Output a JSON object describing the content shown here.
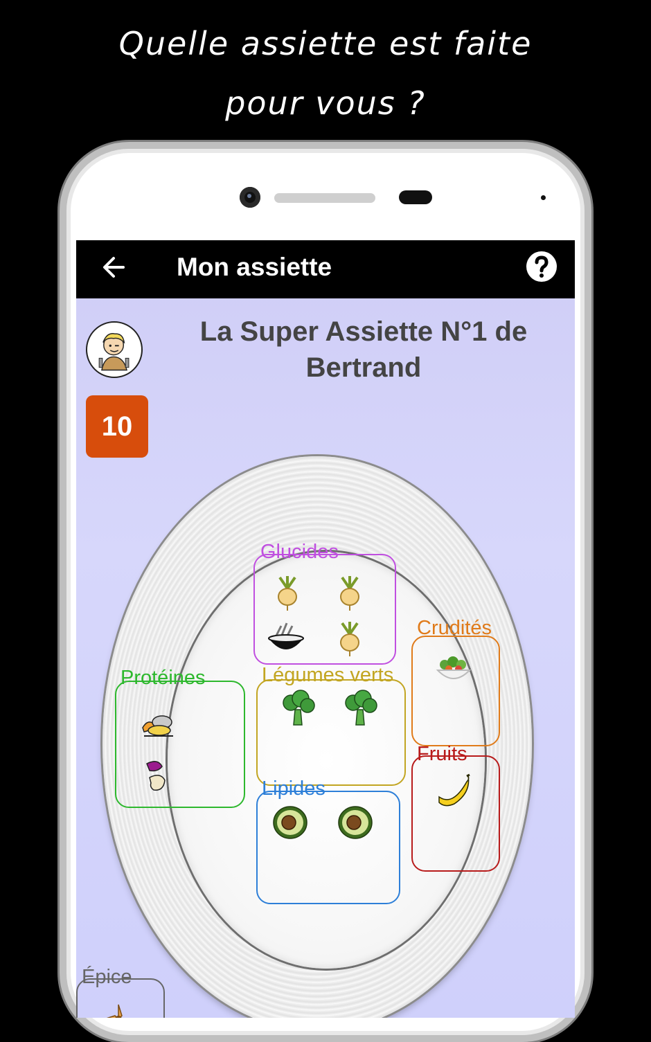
{
  "promo": {
    "line1": "Quelle assiette est faite",
    "line2": "pour vous ?"
  },
  "appbar": {
    "title": "Mon assiette",
    "back_icon": "arrow-left-icon",
    "help_icon": "help-circle-icon"
  },
  "header": {
    "title": "La Super Assiette N°1 de Bertrand",
    "score": "10"
  },
  "zones": {
    "glucides": {
      "label": "Glucides",
      "color": "#c04fe0"
    },
    "cruditees": {
      "label": "Crudités",
      "color": "#e07b1a"
    },
    "proteines": {
      "label": "Protéines",
      "color": "#2db82d"
    },
    "legumes": {
      "label": "Légumes verts",
      "color": "#c2a521"
    },
    "lipides": {
      "label": "Lipides",
      "color": "#2d7fd8"
    },
    "fruits": {
      "label": "Fruits",
      "color": "#b81b1b"
    },
    "epice": {
      "label": "Épice",
      "color": "#666666"
    }
  }
}
